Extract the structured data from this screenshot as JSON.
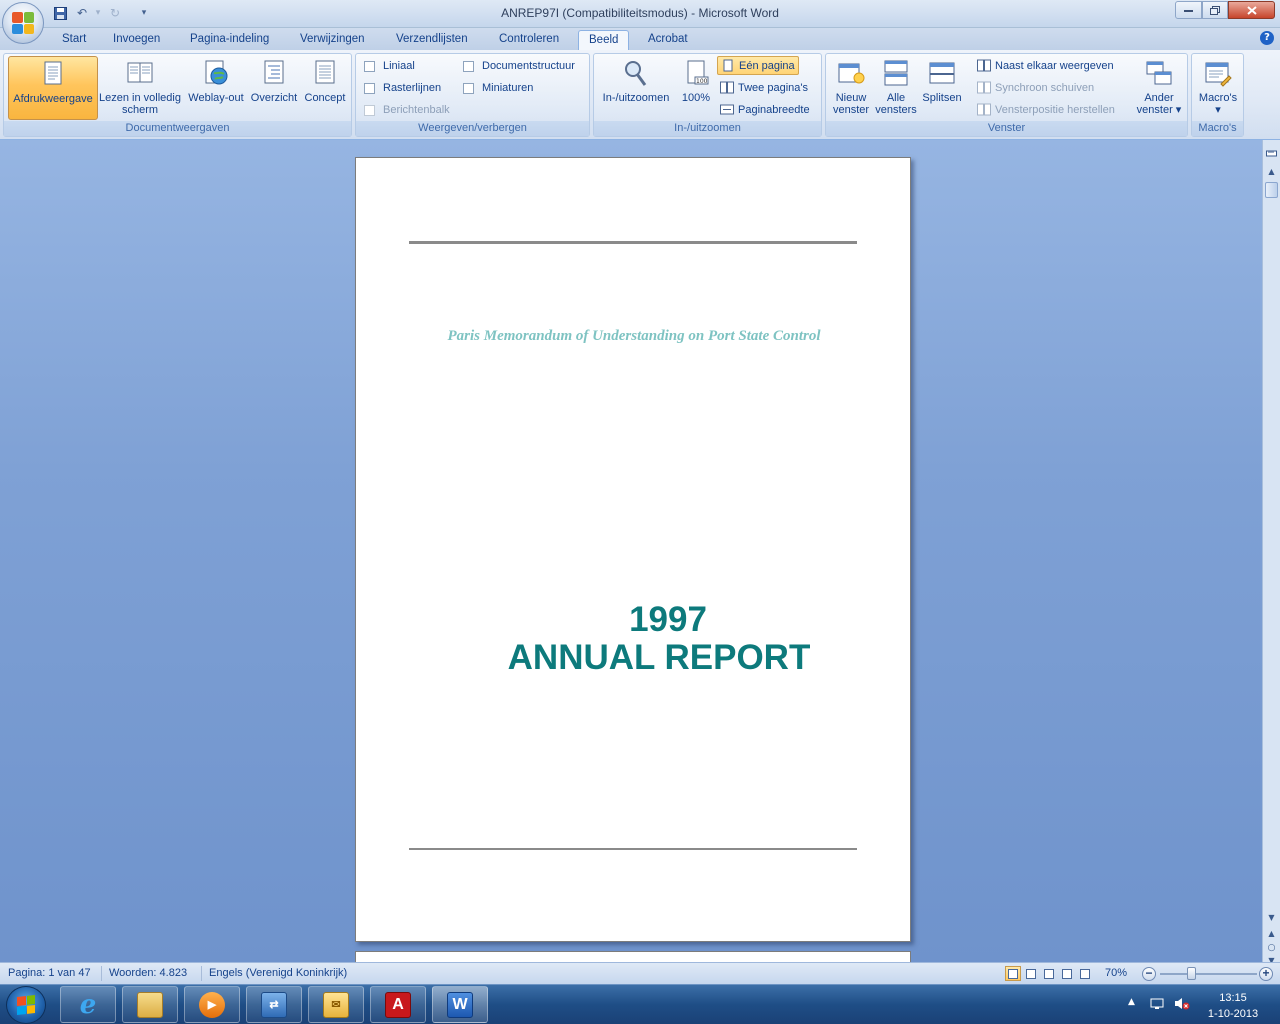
{
  "window": {
    "title": "ANREP97I (Compatibiliteitsmodus) - Microsoft Word",
    "qat": {
      "undo_icon": "undo-icon",
      "redo_icon": "redo-icon",
      "save_icon": "save-icon",
      "customize": "▾"
    }
  },
  "tabs": [
    {
      "label": "Start"
    },
    {
      "label": "Invoegen"
    },
    {
      "label": "Pagina-indeling"
    },
    {
      "label": "Verwijzingen"
    },
    {
      "label": "Verzendlijsten"
    },
    {
      "label": "Controleren"
    },
    {
      "label": "Beeld",
      "active": true
    },
    {
      "label": "Acrobat"
    }
  ],
  "ribbon": {
    "documentweergaven": {
      "label": "Documentweergaven",
      "buttons": [
        {
          "label": "Afdrukweergave",
          "selected": true
        },
        {
          "label": "Lezen in volledig scherm"
        },
        {
          "label": "Weblay-out"
        },
        {
          "label": "Overzicht"
        },
        {
          "label": "Concept"
        }
      ]
    },
    "weergeven": {
      "label": "Weergeven/verbergen",
      "checks": [
        {
          "label": "Liniaal",
          "checked": false
        },
        {
          "label": "Rasterlijnen",
          "checked": false
        },
        {
          "label": "Berichtenbalk",
          "checked": false,
          "disabled": true
        },
        {
          "label": "Documentstructuur",
          "checked": false
        },
        {
          "label": "Miniaturen",
          "checked": false
        }
      ]
    },
    "zoom": {
      "label": "In-/uitzoomen",
      "zoom_btn": "In-/uitzoomen",
      "hundred_btn": "100%",
      "een_pagina": "Eén pagina",
      "twee_paginas": "Twee pagina's",
      "paginabreedte": "Paginabreedte"
    },
    "venster": {
      "label": "Venster",
      "nieuw_line1": "Nieuw",
      "nieuw_line2": "venster",
      "alle_line1": "Alle",
      "alle_line2": "vensters",
      "splitsen": "Splitsen",
      "naast_elkaar": "Naast elkaar weergeven",
      "synchroon": "Synchroon schuiven",
      "vensterpositie": "Vensterpositie herstellen",
      "ander_line1": "Ander",
      "ander_line2": "venster ▾"
    },
    "macros": {
      "label": "Macro's",
      "btn_line1": "Macro's",
      "btn_line2": "▾"
    }
  },
  "document": {
    "subtitle": "Paris Memorandum of Understanding on Port State Control",
    "year": "1997",
    "title": "ANNUAL REPORT",
    "title_color": "#0d7a7c",
    "subtitle_color": "#7ec3c2"
  },
  "statusbar": {
    "page": "Pagina: 1 van 47",
    "words": "Woorden: 4.823",
    "language": "Engels (Verenigd Koninkrijk)",
    "zoom": "70%"
  },
  "taskbar": {
    "apps": [
      {
        "icon": "internet-explorer-icon"
      },
      {
        "icon": "file-explorer-icon"
      },
      {
        "icon": "media-player-icon"
      },
      {
        "icon": "remote-app-icon"
      },
      {
        "icon": "outlook-icon"
      },
      {
        "icon": "acrobat-icon"
      },
      {
        "icon": "word-icon",
        "active": true
      }
    ],
    "time": "13:15",
    "date": "1-10-2013"
  }
}
